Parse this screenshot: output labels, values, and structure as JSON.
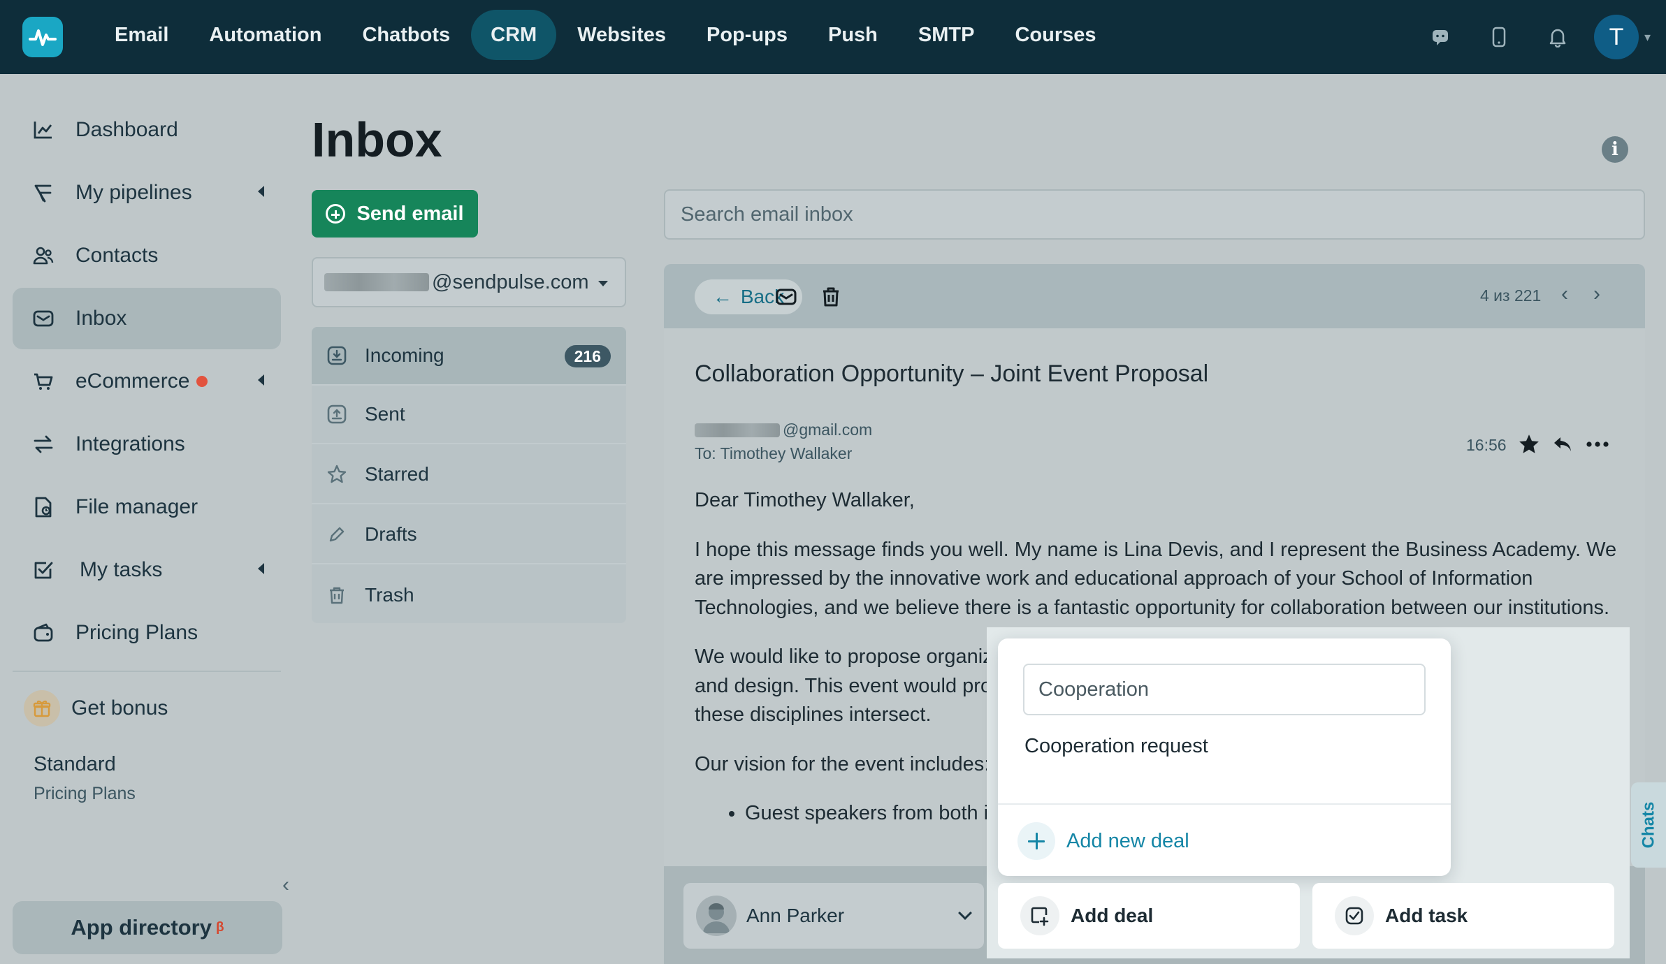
{
  "topnav": {
    "items": [
      {
        "label": "Email",
        "active": false
      },
      {
        "label": "Automation",
        "active": false
      },
      {
        "label": "Chatbots",
        "active": false
      },
      {
        "label": "CRM",
        "active": true
      },
      {
        "label": "Websites",
        "active": false
      },
      {
        "label": "Pop-ups",
        "active": false
      },
      {
        "label": "Push",
        "active": false
      },
      {
        "label": "SMTP",
        "active": false
      },
      {
        "label": "Courses",
        "active": false
      }
    ],
    "avatar_initial": "T"
  },
  "sidebar": {
    "items": [
      {
        "label": "Dashboard",
        "icon": "chart-line-icon"
      },
      {
        "label": "My pipelines",
        "icon": "pipeline-icon",
        "expandable": true
      },
      {
        "label": "Contacts",
        "icon": "contacts-icon"
      },
      {
        "label": "Inbox",
        "icon": "inbox-icon",
        "active": true
      },
      {
        "label": "eCommerce",
        "icon": "cart-icon",
        "expandable": true,
        "notification_dot": true
      },
      {
        "label": "Integrations",
        "icon": "arrows-swap-icon"
      },
      {
        "label": "File manager",
        "icon": "file-manager-icon"
      },
      {
        "label": "My tasks",
        "icon": "task-check-icon",
        "expandable": true
      },
      {
        "label": "Pricing Plans",
        "icon": "wallet-icon"
      }
    ],
    "bonus_label": "Get bonus",
    "plan_name": "Standard",
    "plan_sub": "Pricing Plans",
    "app_directory_label": "App directory",
    "app_directory_badge": "β"
  },
  "page": {
    "title": "Inbox",
    "send_email_label": "Send email",
    "account_suffix": "@sendpulse.com",
    "search_placeholder": "Search email inbox"
  },
  "folders": [
    {
      "label": "Incoming",
      "count": "216",
      "active": true,
      "icon": "incoming-icon"
    },
    {
      "label": "Sent",
      "icon": "sent-icon"
    },
    {
      "label": "Starred",
      "icon": "star-icon"
    },
    {
      "label": "Drafts",
      "icon": "pencil-icon"
    },
    {
      "label": "Trash",
      "icon": "trash-icon"
    }
  ],
  "email": {
    "back_label": "Back",
    "pager": "4 из 221",
    "subject": "Collaboration Opportunity – Joint Event Proposal",
    "from_suffix": "@gmail.com",
    "to": "To: Timothey Wallaker",
    "time": "16:56",
    "body": {
      "greeting": "Dear Timothey Wallaker,",
      "p1": "I hope this message finds you well. My name is Lina Devis, and I represent the Business Academy. We are impressed by the innovative work and educational approach of your School of Information Technologies, and we believe there is a fantastic opportunity for collaboration between our institutions.",
      "p2": "We would like to propose organizing a joint event that brings together experts in technology, business, and design. This event would provide students and professionals with invaluable insights into how these disciplines intersect.",
      "p3": "Our vision for the event includes:",
      "bullet1": "Guest speakers from both institutions"
    }
  },
  "deal_popup": {
    "input_value": "Cooperation",
    "option": "Cooperation request",
    "add_new_label": "Add new deal"
  },
  "bottom": {
    "assignee": "Ann Parker",
    "add_deal_label": "Add deal",
    "add_task_label": "Add task",
    "chats_label": "Chats"
  },
  "colors": {
    "topbar": "#0e2d3a",
    "accent_green": "#16855a",
    "link_blue": "#1586a6",
    "notification_red": "#e2533e"
  }
}
